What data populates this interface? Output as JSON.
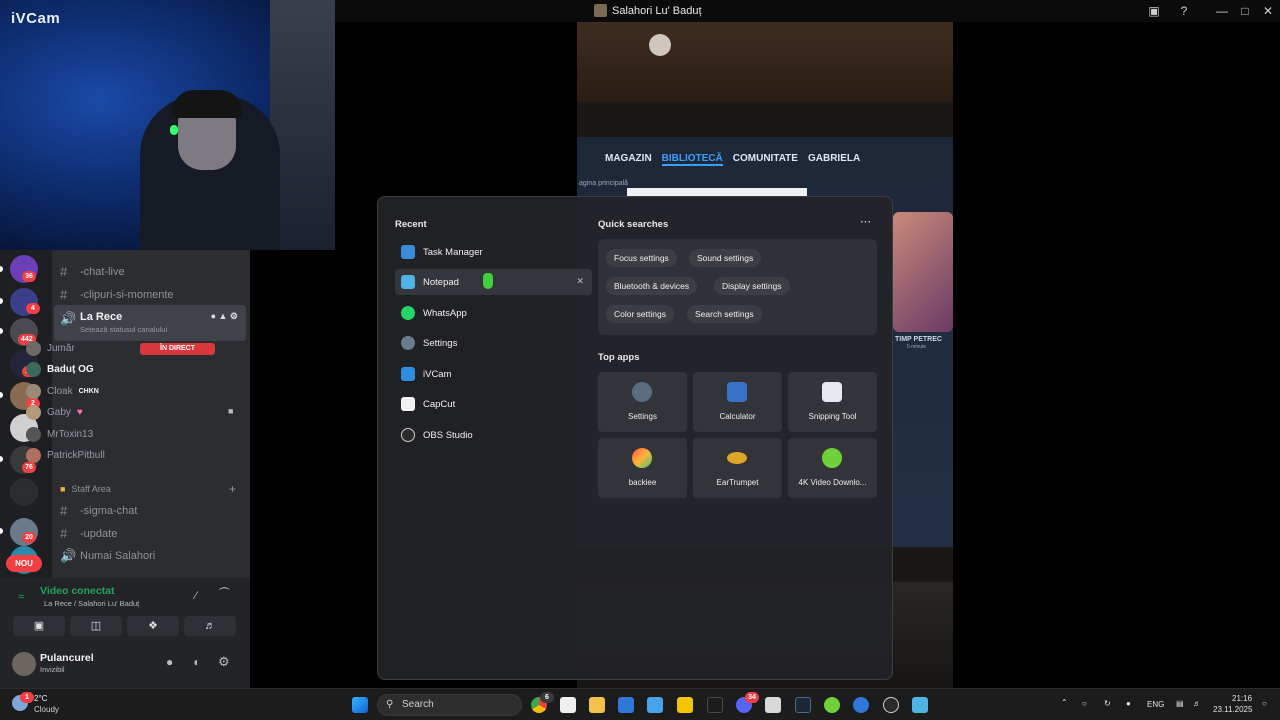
{
  "window": {
    "title": "Salahori Lu' Baduț"
  },
  "webcam": {
    "brand": "iVCam"
  },
  "stream": {
    "nav": [
      "MAGAZIN",
      "BIBLIOTECĂ",
      "COMUNITATE",
      "GABRIELA"
    ],
    "crumb": "agina principală",
    "game_time_label": "TIMP PETREC",
    "game_time_value": "5 minute"
  },
  "discord": {
    "guild_badges": [
      "36",
      "4",
      "442",
      "15",
      "2",
      "2",
      "76",
      "20"
    ],
    "nou": "NOU",
    "channels": {
      "chat_live": "-chat-live",
      "clipuri": "-clipuri-si-momente",
      "voice_selected": "La Rece",
      "voice_status": "Setează statusul canalului",
      "staff_area": "Staff Area",
      "sigma_chat": "-sigma-chat",
      "update": "-update",
      "numai_salahori": "Numai Salahori"
    },
    "members": [
      "Jumăr",
      "Baduț OG",
      "Cloak",
      "Gaby",
      "MrToxin13",
      "PatrickPitbull"
    ],
    "member_tag": "CHKN",
    "live_badge": "ÎN DIRECT",
    "voice": {
      "status": "Video conectat",
      "location": "La Rece / Salahori Lu' Baduț"
    },
    "user": {
      "name": "Pulancurel",
      "status": "Invizibil"
    }
  },
  "start_menu": {
    "recent_title": "Recent",
    "recent": [
      "Task Manager",
      "Notepad",
      "WhatsApp",
      "Settings",
      "iVCam",
      "CapCut",
      "OBS Studio"
    ],
    "quick_title": "Quick searches",
    "quick": [
      "Focus settings",
      "Sound settings",
      "Bluetooth & devices",
      "Display settings",
      "Color settings",
      "Search settings"
    ],
    "top_apps_title": "Top apps",
    "top_apps": [
      "Settings",
      "Calculator",
      "Snipping Tool",
      "backiee",
      "EarTrumpet",
      "4K Video Downlo..."
    ]
  },
  "taskbar": {
    "weather_temp": "2°C",
    "weather_desc": "Cloudy",
    "search_placeholder": "Search",
    "lang": "ENG",
    "time": "21:16",
    "date": "23.11.2025",
    "badges": {
      "weather": "1",
      "chrome": "6",
      "discord": "34"
    }
  },
  "colors": {
    "accent": "#3aa0ff",
    "discord_bg": "#2b2d31",
    "danger": "#da373c",
    "voice_green": "#23a55a"
  }
}
